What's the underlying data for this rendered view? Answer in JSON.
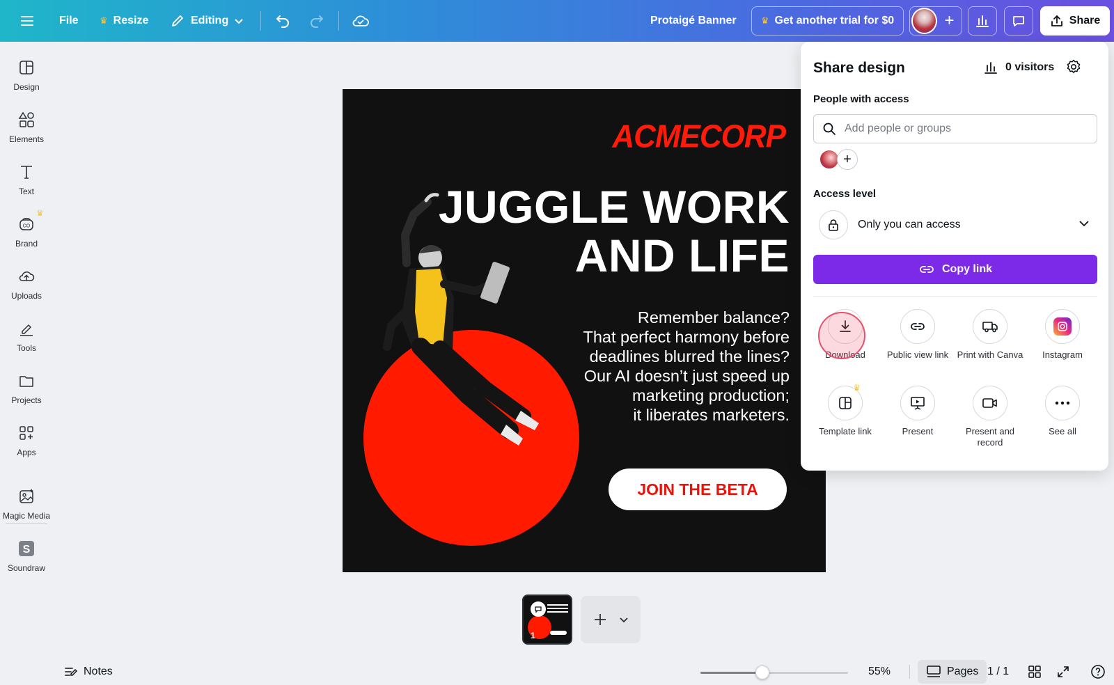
{
  "topbar": {
    "file": "File",
    "resize": "Resize",
    "editing": "Editing",
    "title": "Protaigé Banner",
    "trial": "Get another trial for $0",
    "share": "Share"
  },
  "sidebar": {
    "items": [
      {
        "label": "Design",
        "icon": "design-icon"
      },
      {
        "label": "Elements",
        "icon": "elements-icon"
      },
      {
        "label": "Text",
        "icon": "text-icon"
      },
      {
        "label": "Brand",
        "icon": "brand-icon"
      },
      {
        "label": "Uploads",
        "icon": "uploads-icon"
      },
      {
        "label": "Tools",
        "icon": "tools-icon"
      },
      {
        "label": "Projects",
        "icon": "projects-icon"
      },
      {
        "label": "Apps",
        "icon": "apps-icon"
      },
      {
        "label": "Magic Media",
        "icon": "magic-media-icon"
      },
      {
        "label": "Soundraw",
        "icon": "soundraw-icon"
      }
    ]
  },
  "design": {
    "logo": "ACMECORP",
    "headline_1": "JUGGLE WORK",
    "headline_2": "AND LIFE",
    "body_1": "Remember balance?",
    "body_2": "That perfect harmony before",
    "body_3": "deadlines blurred the lines?",
    "body_4": "Our AI doesn’t just speed up",
    "body_5": "marketing production;",
    "body_6": "it liberates marketers.",
    "cta": "JOIN THE BETA",
    "colors": {
      "background": "#111111",
      "accent": "#ff1a00",
      "person_top": "#f5c11b"
    }
  },
  "pages": {
    "thumb_number": "1",
    "current": "1 / 1",
    "pages_label": "Pages"
  },
  "bottombar": {
    "notes": "Notes",
    "zoom": "55%",
    "zoom_fraction": 0.42
  },
  "share_panel": {
    "title": "Share design",
    "visitors": "0 visitors",
    "people_label": "People with access",
    "search_placeholder": "Add people or groups",
    "access_label": "Access level",
    "access_value": "Only you can access",
    "copy_link": "Copy link",
    "options": [
      {
        "label": "Download",
        "icon": "download-icon"
      },
      {
        "label": "Public view link",
        "icon": "link-icon"
      },
      {
        "label": "Print with Canva",
        "icon": "truck-icon"
      },
      {
        "label": "Instagram",
        "icon": "instagram-icon"
      },
      {
        "label": "Template link",
        "icon": "template-icon"
      },
      {
        "label": "Present",
        "icon": "present-icon"
      },
      {
        "label": "Present and record",
        "icon": "video-icon"
      },
      {
        "label": "See all",
        "icon": "more-icon"
      }
    ],
    "accent_color": "#7d2ae8"
  }
}
